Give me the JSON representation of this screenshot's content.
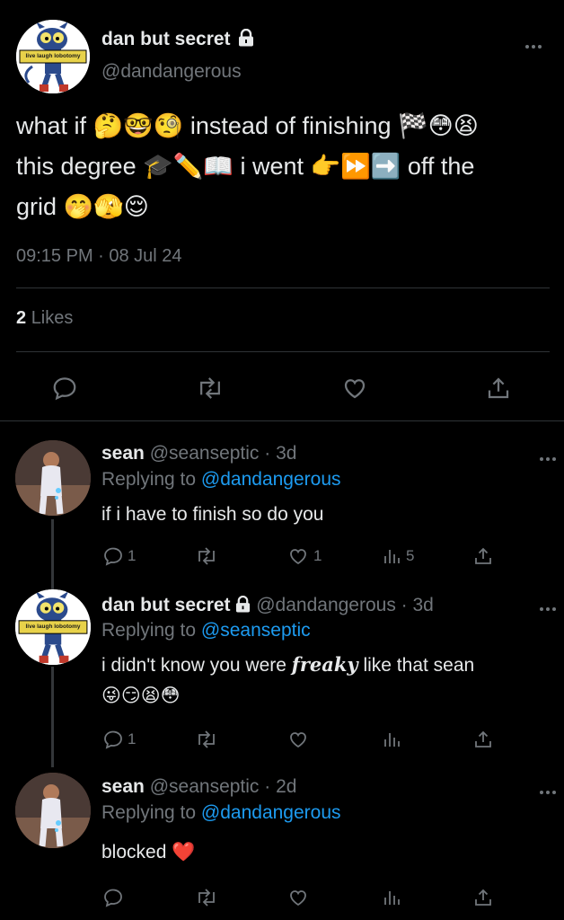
{
  "main_tweet": {
    "author_name": "dan but secret",
    "lock_icon": "lock-icon",
    "handle": "@dandangerous",
    "avatar_badge": "live laugh lobotomy",
    "text_line1": "what if 🤔🤓🧐  instead of finishing 🏁😳😫",
    "text_line2": "this degree 🎓✏️📖  i went 👉⏩➡️  off the",
    "text_line3": "grid 🤭🫣😌",
    "time": "09:15 PM · 08 Jul 24",
    "likes_count": "2",
    "likes_label": "Likes",
    "actions": [
      "reply-icon",
      "retweet-icon",
      "like-icon",
      "share-icon"
    ]
  },
  "replies": [
    {
      "author_name": "sean",
      "handle_time": "@seanseptic · 3d",
      "replying_label": "Replying to",
      "replying_to": "@dandangerous",
      "text": "if i have to finish so do you",
      "reply_count": "1",
      "like_count": "1",
      "views_count": "5"
    },
    {
      "author_name": "dan but secret",
      "handle_time": "@dandangerous · 3d",
      "replying_label": "Replying to",
      "replying_to": "@seanseptic",
      "avatar_badge": "live laugh lobotomy",
      "text_before": "i didn't know you were ",
      "text_styled": "freaky",
      "text_after": " like that sean",
      "text_line2": "😜😏😫😳",
      "reply_count": "1"
    },
    {
      "author_name": "sean",
      "handle_time": "@seanseptic · 2d",
      "replying_label": "Replying to",
      "replying_to": "@dandangerous",
      "text": "blocked ❤️"
    }
  ],
  "colors": {
    "background": "#000000",
    "text": "#e7e9ea",
    "muted": "#71767b",
    "link": "#1d9bf0",
    "divider": "#2f3336"
  }
}
